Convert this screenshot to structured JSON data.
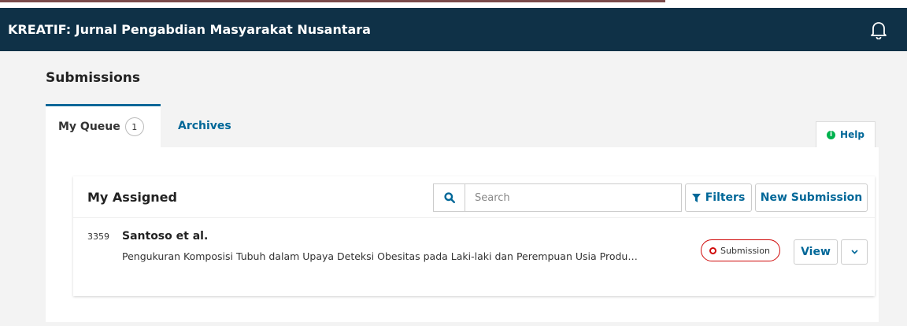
{
  "header": {
    "journal_title": "KREATIF: Jurnal Pengabdian Masyarakat Nusantara",
    "notifications_icon": "bell-icon"
  },
  "page": {
    "title": "Submissions"
  },
  "tabs": [
    {
      "label": "My Queue",
      "count": "1",
      "active": true
    },
    {
      "label": "Archives",
      "active": false
    }
  ],
  "help": {
    "label": "Help",
    "icon": "info-icon"
  },
  "list": {
    "title": "My Assigned",
    "search_placeholder": "Search",
    "search_icon": "search-icon",
    "filters_label": "Filters",
    "filters_icon": "filter-icon",
    "new_submission_label": "New Submission",
    "items": [
      {
        "id": "3359",
        "authors": "Santoso et al.",
        "title": "Pengukuran Komposisi Tubuh dalam Upaya Deteksi Obesitas pada Laki-laki dan Perempuan Usia Produ…",
        "stage": "Submission",
        "view_label": "View",
        "expand_icon": "chevron-down-icon"
      }
    ]
  },
  "colors": {
    "header_bg": "#0f3147",
    "link_blue": "#006798",
    "stage_red": "#d00a0a",
    "help_green": "#00b24e"
  }
}
